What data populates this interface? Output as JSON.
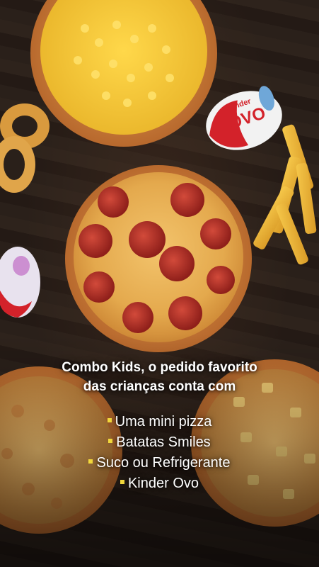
{
  "colors": {
    "bullet": "#f3d93c",
    "text": "#ffffff",
    "table_wood": "#2a201a",
    "pizza_crust": "#c97b3a",
    "pepperoni": "#b9322a",
    "corn": "#f0c53a",
    "kinder_red": "#d3222a"
  },
  "promo": {
    "headline_line1": "Combo Kids, o pedido favorito",
    "headline_line2": "das crianças conta com",
    "items": [
      "Uma mini pizza",
      "Batatas Smiles",
      "Suco ou Refrigerante",
      "Kinder Ovo"
    ]
  },
  "photo": {
    "kinder_egg_brand": "Kinder",
    "kinder_egg_label": "OVO"
  },
  "icons": {
    "bullet": "yellow-square-bullet-icon"
  }
}
